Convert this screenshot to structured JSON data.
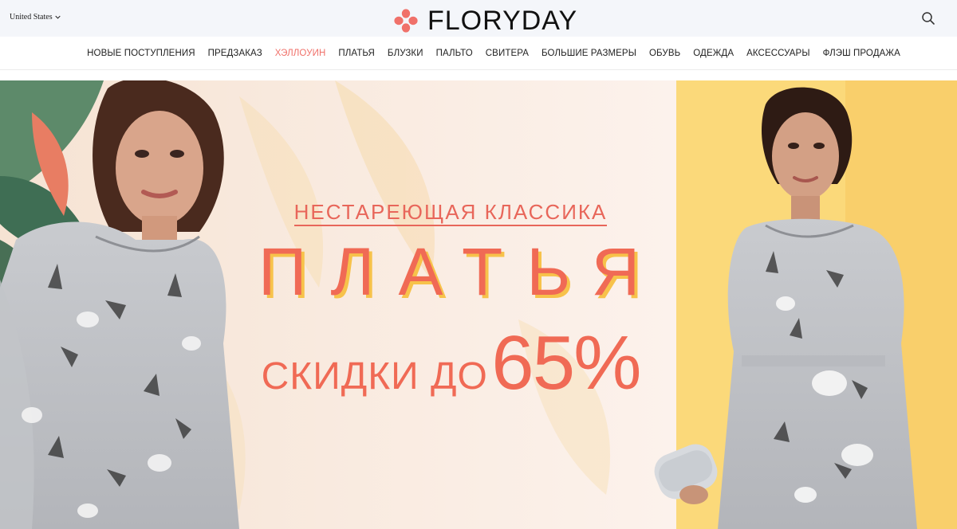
{
  "header": {
    "region_label": "United States",
    "logo_text": "FLORYDAY",
    "icons": {
      "region_chevron": "chevron-down-icon",
      "logo": "flower-logo-icon",
      "search": "search-icon"
    },
    "brand_color": "#f0716a"
  },
  "nav": {
    "items": [
      {
        "label": "НОВЫЕ ПОСТУПЛЕНИЯ",
        "accent": false
      },
      {
        "label": "ПРЕДЗАКАЗ",
        "accent": false
      },
      {
        "label": "ХЭЛЛОУИН",
        "accent": true
      },
      {
        "label": "ПЛАТЬЯ",
        "accent": false
      },
      {
        "label": "БЛУЗКИ",
        "accent": false
      },
      {
        "label": "ПАЛЬТО",
        "accent": false
      },
      {
        "label": "СВИТЕРА",
        "accent": false
      },
      {
        "label": "БОЛЬШИЕ РАЗМЕРЫ",
        "accent": false
      },
      {
        "label": "ОБУВЬ",
        "accent": false
      },
      {
        "label": "ОДЕЖДА",
        "accent": false
      },
      {
        "label": "АКСЕССУАРЫ",
        "accent": false
      },
      {
        "label": "ФЛЭШ ПРОДАЖА",
        "accent": false
      }
    ]
  },
  "banner": {
    "subtitle": "НЕСТАРЕЮЩАЯ КЛАССИКА",
    "title": "ПЛАТЬЯ",
    "offer_prefix": "СКИДКИ ДО",
    "offer_value": "65%",
    "colors": {
      "text": "#f06a55",
      "shadow": "#f7c24a",
      "background": "#fbeee6",
      "right_panel": "#fbd97a"
    }
  }
}
